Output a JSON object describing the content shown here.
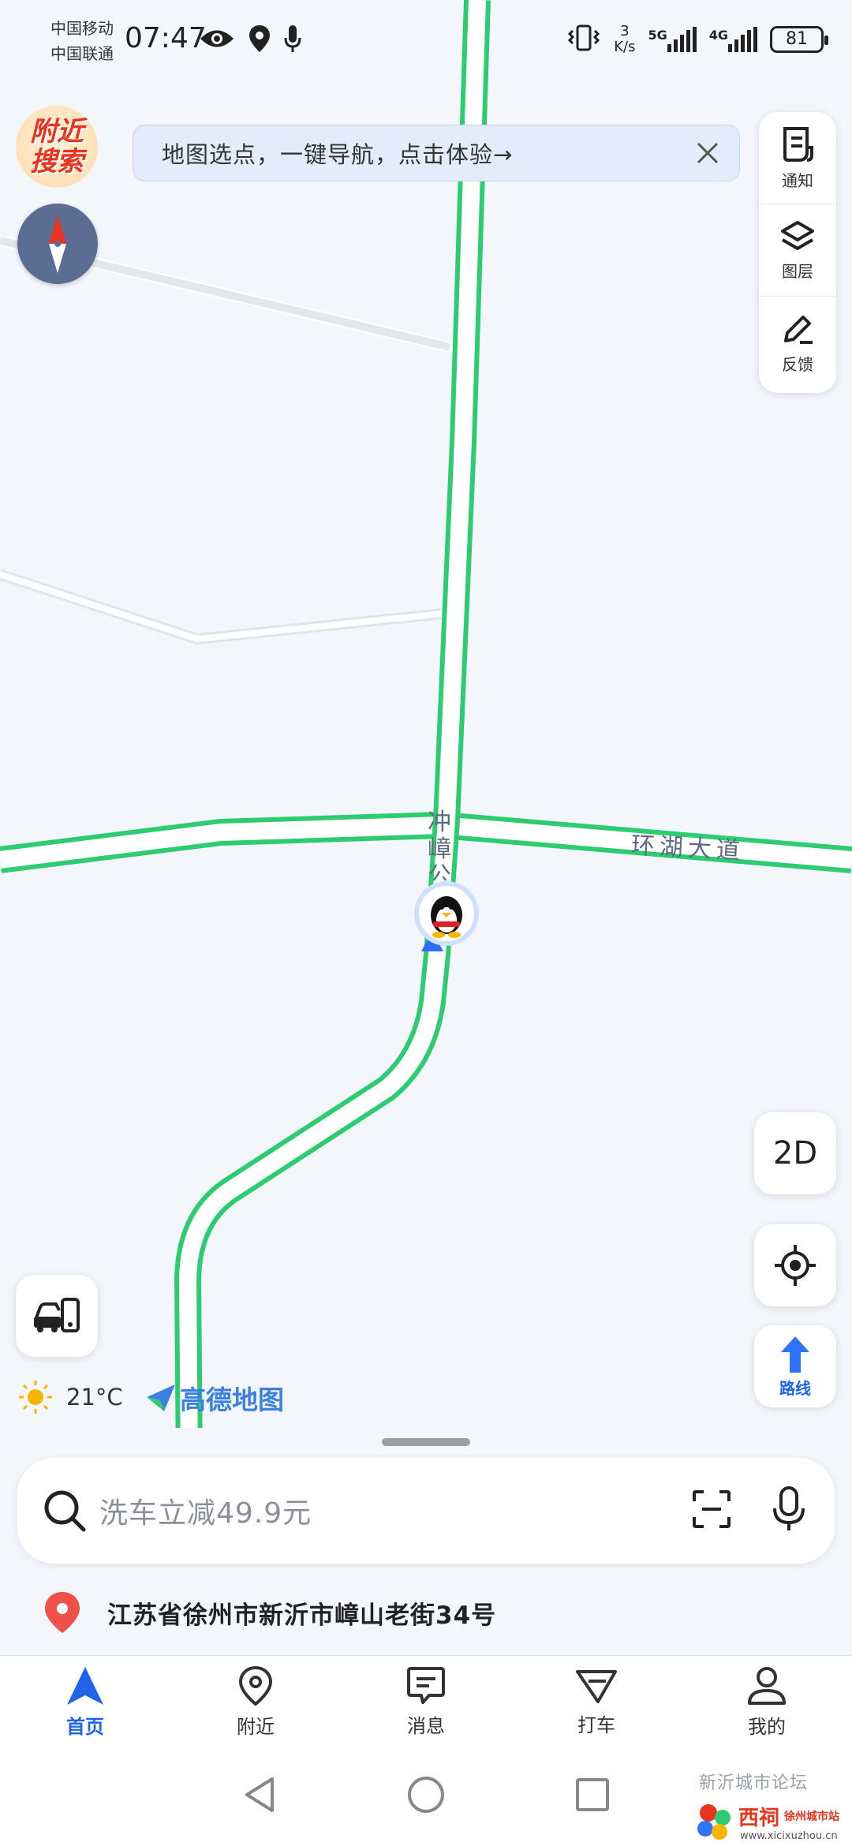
{
  "status_bar": {
    "carrier_1": "中国移动",
    "carrier_2": "中国联通",
    "time": "07:47",
    "speed_value": "3",
    "speed_unit": "K/s",
    "network_1": "5G",
    "network_2": "4G",
    "battery": "81"
  },
  "map": {
    "nearby_badge_line1": "附近",
    "nearby_badge_line2": "搜索",
    "tip_text": "地图选点，一键导航，点击体验→",
    "road_label_lake": "环湖大道",
    "road_label_vertical": "冲嶂公",
    "tools": [
      {
        "label": "通知",
        "icon": "notice-icon"
      },
      {
        "label": "图层",
        "icon": "layers-icon"
      },
      {
        "label": "反馈",
        "icon": "feedback-edit-icon"
      }
    ],
    "btn_2d": "2D",
    "btn_route": "路线",
    "weather_temp": "21°C",
    "brand_name": "高德地图"
  },
  "search": {
    "placeholder": "洗车立减49.9元"
  },
  "address": "江苏省徐州市新沂市嶂山老街34号",
  "tabs": [
    {
      "label": "首页",
      "icon": "home-navigation-icon",
      "active": true
    },
    {
      "label": "附近",
      "icon": "nearby-pin-icon",
      "active": false
    },
    {
      "label": "消息",
      "icon": "message-icon",
      "active": false
    },
    {
      "label": "打车",
      "icon": "taxi-icon",
      "active": false
    },
    {
      "label": "我的",
      "icon": "profile-icon",
      "active": false
    }
  ],
  "watermark": {
    "forum": "新沂城市论坛",
    "brand": "西祠",
    "sub": "徐州城市站",
    "url": "www.xicixuzhou.cn"
  },
  "colors": {
    "road_border": "#2ecc71",
    "accent_blue": "#1f63e8",
    "map_bg": "#f3f6fa"
  }
}
